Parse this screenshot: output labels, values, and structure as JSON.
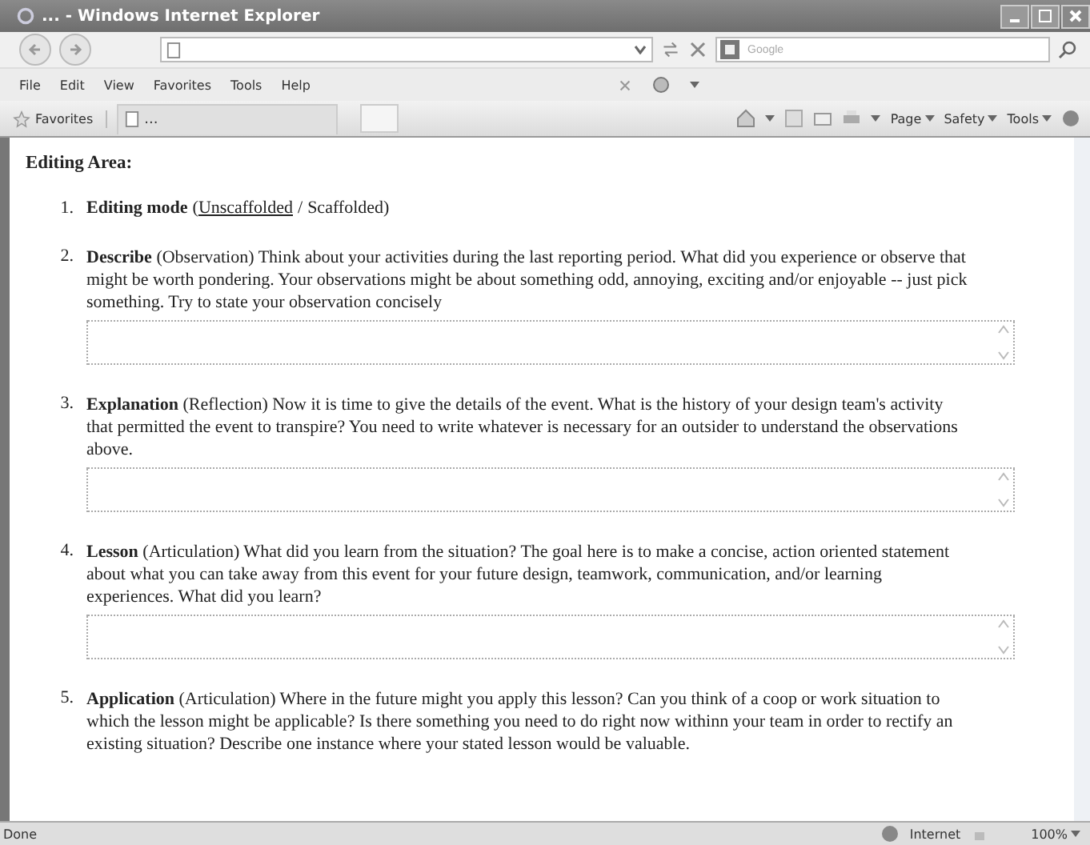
{
  "window": {
    "title": "... - Windows Internet Explorer"
  },
  "search": {
    "placeholder": "Google"
  },
  "menu": [
    "File",
    "Edit",
    "View",
    "Favorites",
    "Tools",
    "Help"
  ],
  "favorites_button": "Favorites",
  "tab": {
    "title": "..."
  },
  "command_bar": [
    "Page",
    "Safety",
    "Tools"
  ],
  "content": {
    "heading": "Editing Area:",
    "items": [
      {
        "kind": "mode",
        "number": "1.",
        "term": "Editing mode",
        "open": "(",
        "separator": "/",
        "close": ")",
        "options": [
          {
            "label": "Unscaffolded",
            "selected": true
          },
          {
            "label": "Scaffolded",
            "selected": false
          }
        ]
      },
      {
        "kind": "question",
        "number": "2.",
        "text": "**Describe** (Observation) Think about your activities during the last reporting period. What did you experience or observe that might be worth pondering. Your observations might be about something odd, annoying, exciting and/or enjoyable -- just pick something. Try to state your observation concisely",
        "answer_box": true
      },
      {
        "kind": "question",
        "number": "3.",
        "text": "**Explanation** (Reflection) Now it is time to give the details of the event. What is the history of your design team's activity that permitted the event to transpire? You need to write whatever is necessary for an outsider to understand the observations above.",
        "answer_box": true
      },
      {
        "kind": "question",
        "number": "4.",
        "text": "**Lesson** (Articulation) What did you learn from the situation? The goal here is to make a concise, action oriented statement about what you can take away from this event for your future design, teamwork, communication, and/or learning experiences. What did you learn?",
        "answer_box": true
      },
      {
        "kind": "question",
        "number": "5.",
        "text": "**Application** (Articulation) Where in the future might you apply this lesson? Can you think of a coop or work situation to which the lesson might be applicable? Is there something you need to do right now withinn your team in order to rectify an existing situation? Describe one instance where your stated lesson would be valuable.",
        "answer_box": false
      }
    ]
  },
  "status_bar": {
    "text": "Done",
    "zone": "Internet",
    "zoom": "100%"
  }
}
